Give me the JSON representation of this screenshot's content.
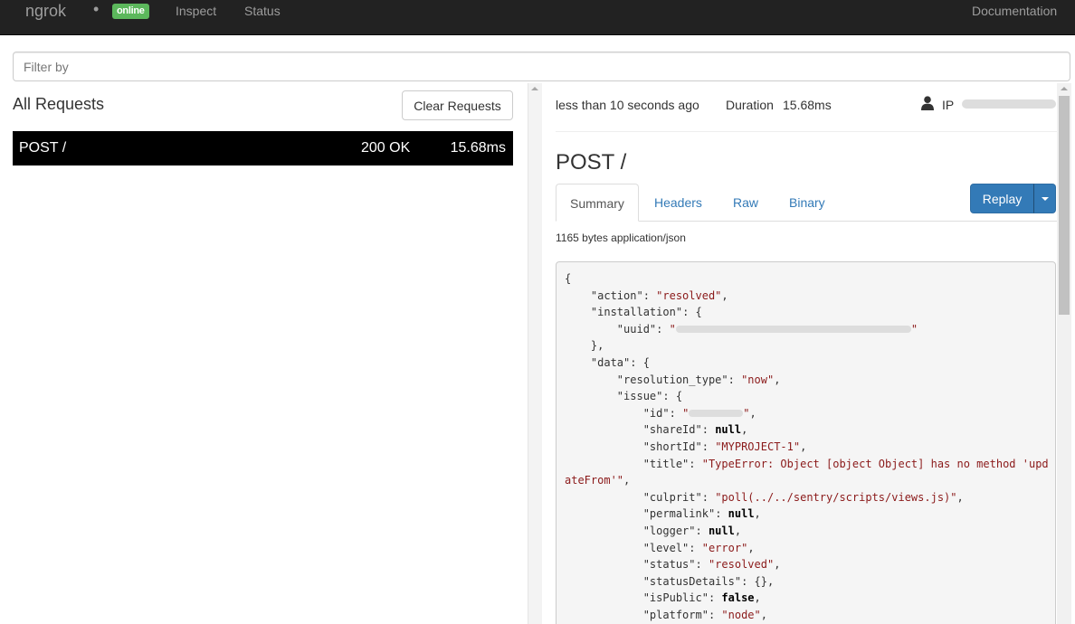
{
  "nav": {
    "brand": "ngrok",
    "dot": "•",
    "status_badge": "online",
    "inspect": "Inspect",
    "status": "Status",
    "documentation": "Documentation"
  },
  "filter": {
    "placeholder": "Filter by"
  },
  "requests": {
    "title": "All Requests",
    "clear_label": "Clear Requests",
    "items": [
      {
        "method_path": "POST /",
        "status": "200 OK",
        "duration": "15.68ms"
      }
    ]
  },
  "detail": {
    "time": "less than 10 seconds ago",
    "duration_label": "Duration",
    "duration_value": "15.68ms",
    "ip_label": "IP",
    "title": "POST /",
    "tabs": [
      "Summary",
      "Headers",
      "Raw",
      "Binary"
    ],
    "replay_label": "Replay",
    "size_info": "1165 bytes application/json",
    "json": {
      "open": "{",
      "action_key": "\"action\"",
      "action_val": "\"resolved\"",
      "installation_key": "\"installation\"",
      "uuid_key": "\"uuid\"",
      "data_key": "\"data\"",
      "resolution_type_key": "\"resolution_type\"",
      "resolution_type_val": "\"now\"",
      "issue_key": "\"issue\"",
      "id_key": "\"id\"",
      "shareId_key": "\"shareId\"",
      "shortId_key": "\"shortId\"",
      "shortId_val": "\"MYPROJECT-1\"",
      "title_key": "\"title\"",
      "title_val_1": "\"TypeError: Object [object Object] has no method 'upd",
      "title_val_2": "ateFrom'\"",
      "culprit_key": "\"culprit\"",
      "culprit_val": "\"poll(../../sentry/scripts/views.js)\"",
      "permalink_key": "\"permalink\"",
      "logger_key": "\"logger\"",
      "level_key": "\"level\"",
      "level_val": "\"error\"",
      "status_key": "\"status\"",
      "status_val": "\"resolved\"",
      "statusDetails_key": "\"statusDetails\"",
      "isPublic_key": "\"isPublic\"",
      "platform_key": "\"platform\"",
      "platform_val": "\"node\"",
      "null": "null",
      "false": "false",
      "empty_obj": "{}",
      "quote": "\""
    }
  },
  "colors": {
    "navbar": "#222222",
    "badge_green": "#5cb85c",
    "selected_row": "#000000",
    "link_blue": "#337ab7",
    "string_red": "#8b1a1a"
  }
}
